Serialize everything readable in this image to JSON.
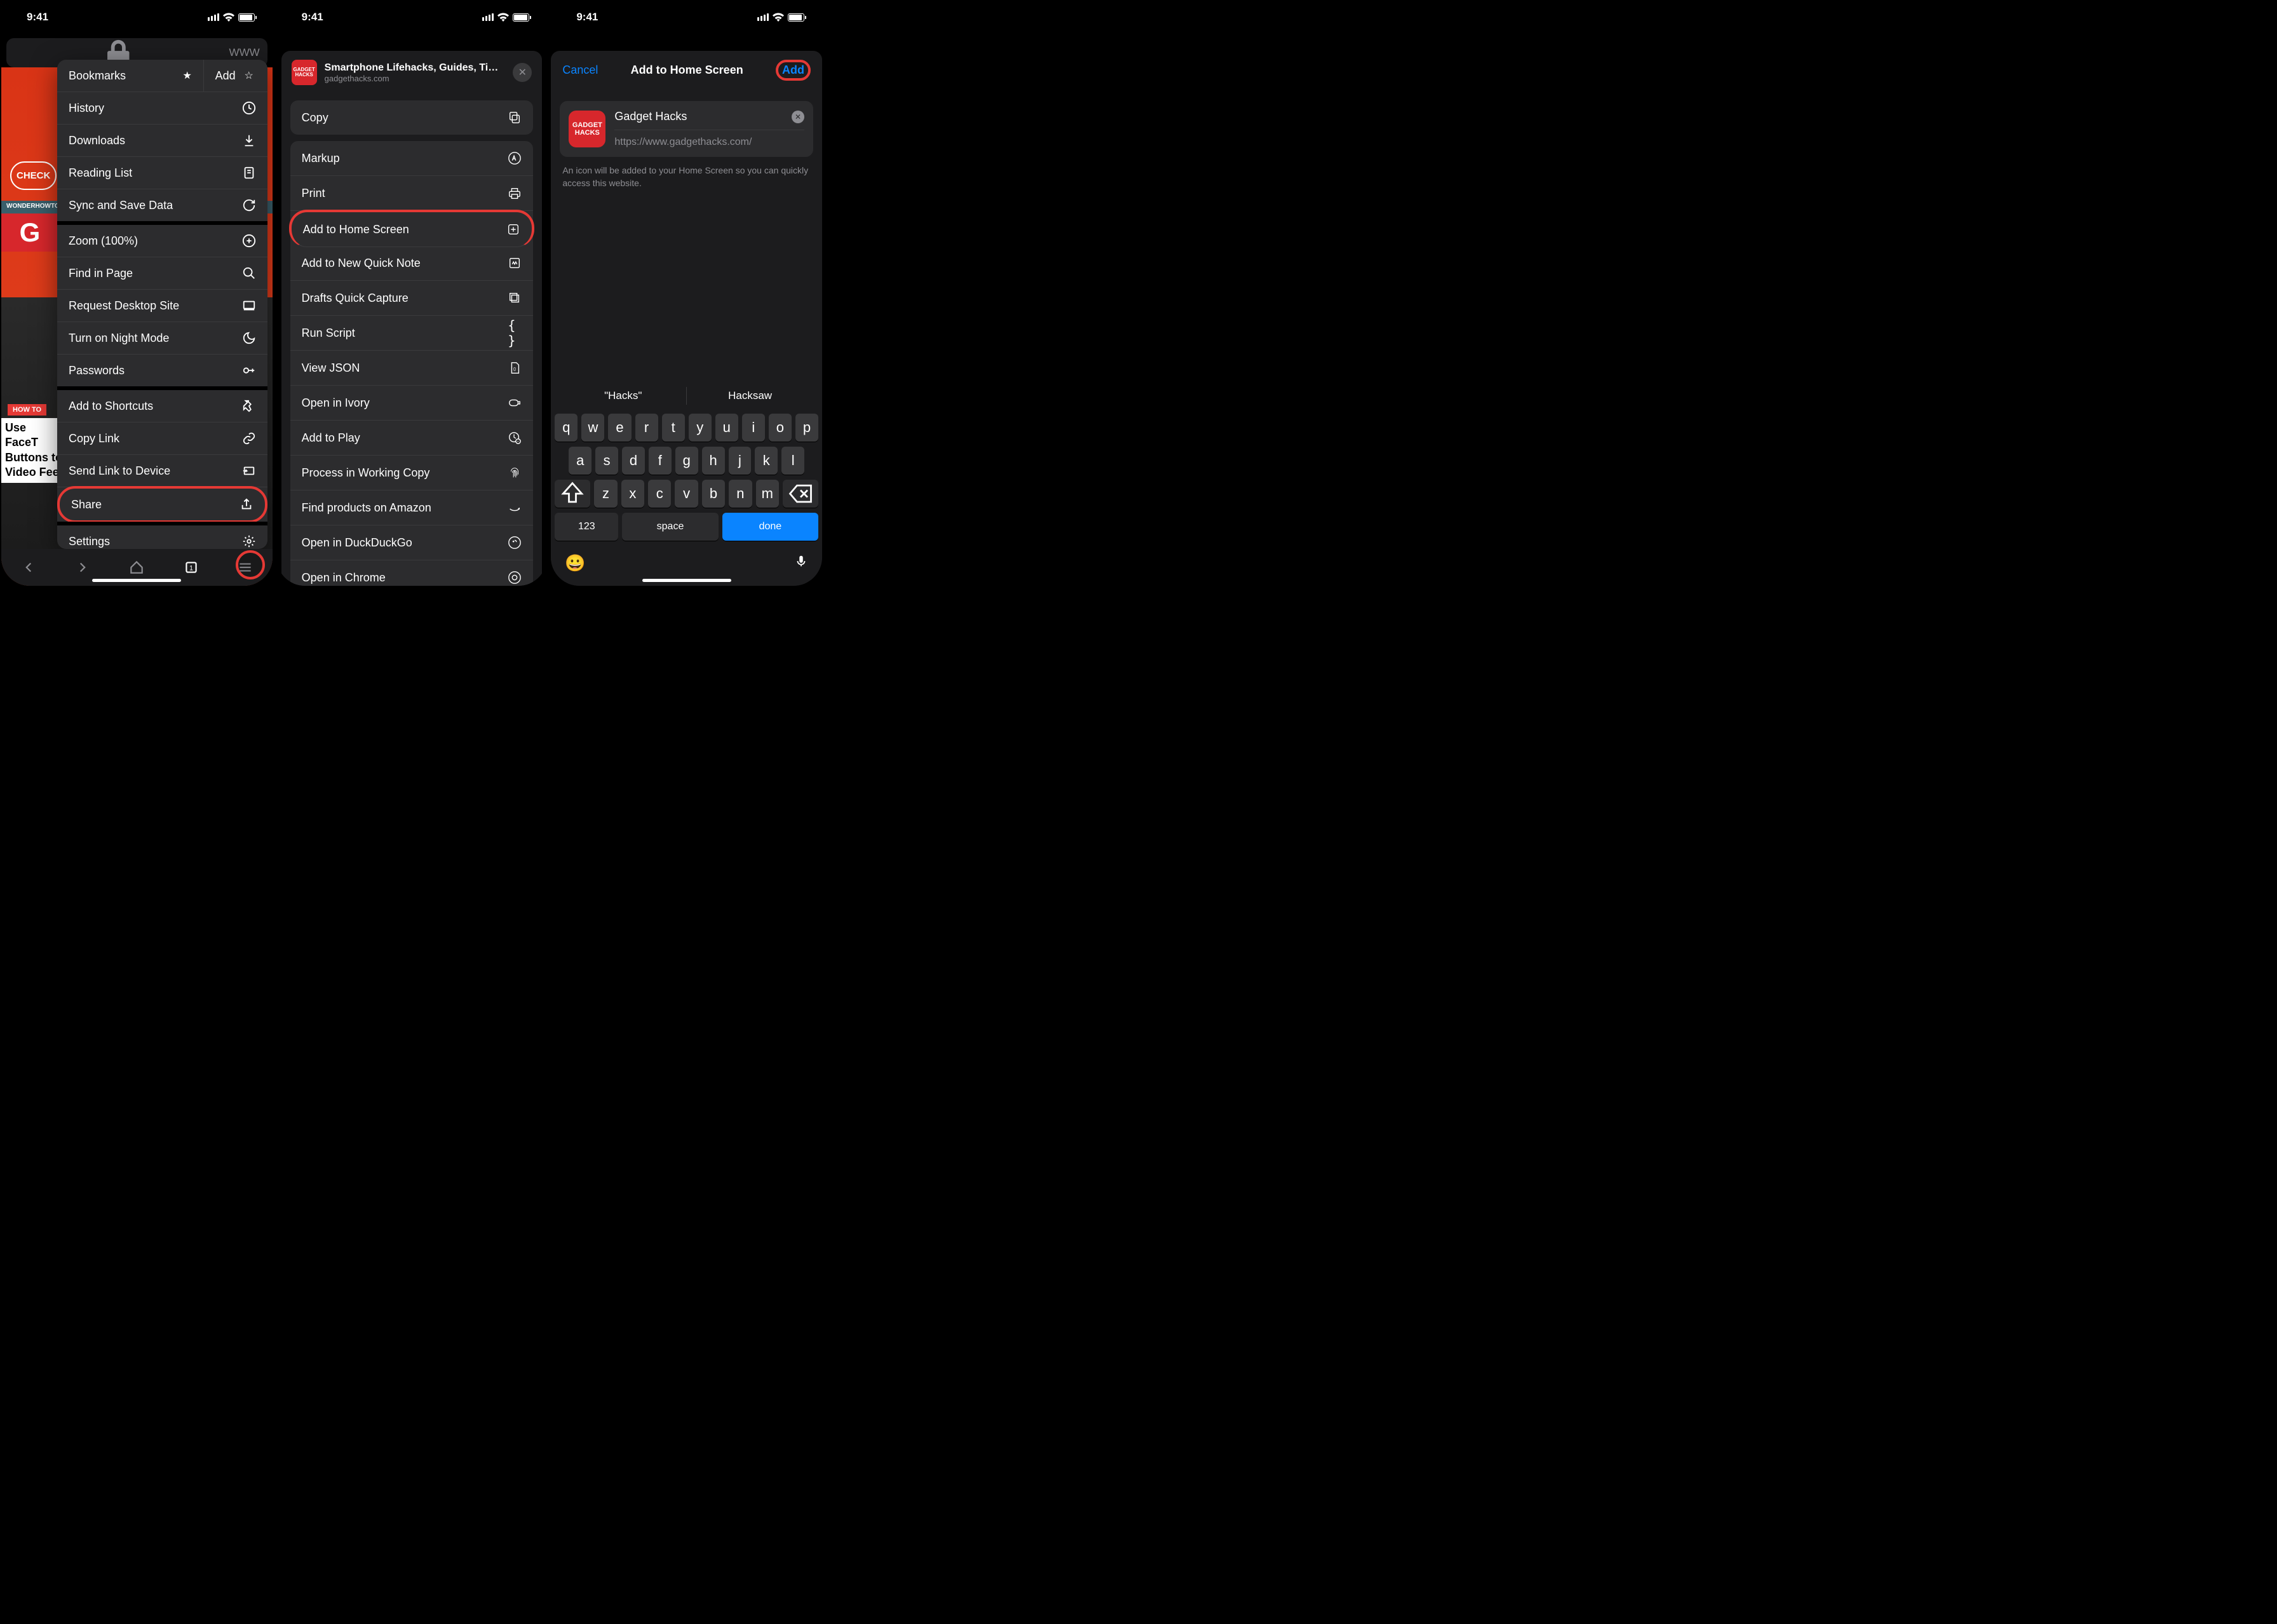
{
  "status": {
    "time": "9:41"
  },
  "phone1": {
    "url_prefix": "WWW",
    "bg": {
      "wonder": "WONDERHOWTO",
      "check": "CHECK",
      "howto": "HOW TO",
      "article": "Use FaceT\nButtons to\nVideo Fee"
    },
    "menu": {
      "bookmarks": "Bookmarks",
      "add": "Add",
      "history": "History",
      "downloads": "Downloads",
      "reading_list": "Reading List",
      "sync": "Sync and Save Data",
      "zoom": "Zoom (100%)",
      "find": "Find in Page",
      "desktop": "Request Desktop Site",
      "night": "Turn on Night Mode",
      "passwords": "Passwords",
      "shortcuts": "Add to Shortcuts",
      "copy_link": "Copy Link",
      "send_link": "Send Link to Device",
      "share": "Share",
      "settings": "Settings"
    }
  },
  "phone2": {
    "header": {
      "title": "Smartphone Lifehacks, Guides, Ti…",
      "sub": "gadgethacks.com",
      "icon_text": "GADGET\nHACKS"
    },
    "actions": {
      "copy": "Copy",
      "markup": "Markup",
      "print": "Print",
      "add_home": "Add to Home Screen",
      "quick_note": "Add to New Quick Note",
      "drafts": "Drafts Quick Capture",
      "run_script": "Run Script",
      "view_json": "View JSON",
      "ivory": "Open in Ivory",
      "play": "Add to Play",
      "working_copy": "Process in Working Copy",
      "amazon": "Find products on Amazon",
      "duckduckgo": "Open in DuckDuckGo",
      "chrome": "Open in Chrome"
    }
  },
  "phone3": {
    "cancel": "Cancel",
    "title": "Add to Home Screen",
    "add": "Add",
    "name": "Gadget Hacks",
    "url": "https://www.gadgethacks.com/",
    "help": "An icon will be added to your Home Screen so you can quickly access this website.",
    "icon_text": "GADGET\nHACKS",
    "suggestions": [
      "\"Hacks\"",
      "Hacksaw"
    ],
    "row1": [
      "q",
      "w",
      "e",
      "r",
      "t",
      "y",
      "u",
      "i",
      "o",
      "p"
    ],
    "row2": [
      "a",
      "s",
      "d",
      "f",
      "g",
      "h",
      "j",
      "k",
      "l"
    ],
    "row3": [
      "z",
      "x",
      "c",
      "v",
      "b",
      "n",
      "m"
    ],
    "k123": "123",
    "space": "space",
    "done": "done"
  }
}
